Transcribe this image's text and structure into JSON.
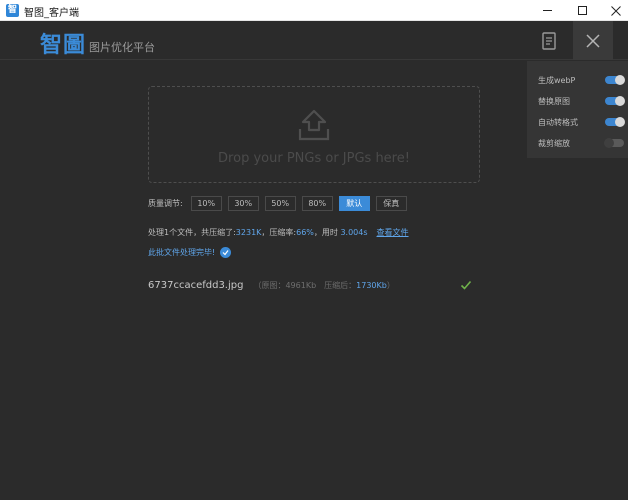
{
  "window": {
    "title": "智图_客户端",
    "icon_glyph": "智"
  },
  "header": {
    "logo": "智圖",
    "subtitle": "图片优化平台"
  },
  "settings": {
    "items": [
      {
        "label": "生成webP",
        "enabled": true
      },
      {
        "label": "替换原图",
        "enabled": true
      },
      {
        "label": "自动转格式",
        "enabled": true
      },
      {
        "label": "裁剪缩放",
        "enabled": false
      }
    ]
  },
  "dropzone": {
    "text": "Drop your PNGs or JPGs here!"
  },
  "quality": {
    "label": "质量调节:",
    "options": [
      "10%",
      "30%",
      "50%",
      "80%",
      "默认",
      "保真"
    ],
    "selected": "默认"
  },
  "summary": {
    "prefix": "处理1个文件，共压缩了:",
    "saved": "3231K",
    "ratio_label": "，压缩率:",
    "ratio": "66%",
    "time_label": "，用时",
    "time": "3.004s",
    "view_link": "查看文件"
  },
  "done_message": "此批文件处理完毕!",
  "file": {
    "name": "6737ccacefdd3.jpg",
    "original_label": "（原图：4961Kb",
    "compressed_label": "压缩后：",
    "compressed_value": "1730Kb",
    "compressed_suffix": "）"
  },
  "colors": {
    "accent": "#3b8bd8",
    "link": "#5fa5ea",
    "success": "#6fb24a",
    "background": "#2b2b2b"
  }
}
